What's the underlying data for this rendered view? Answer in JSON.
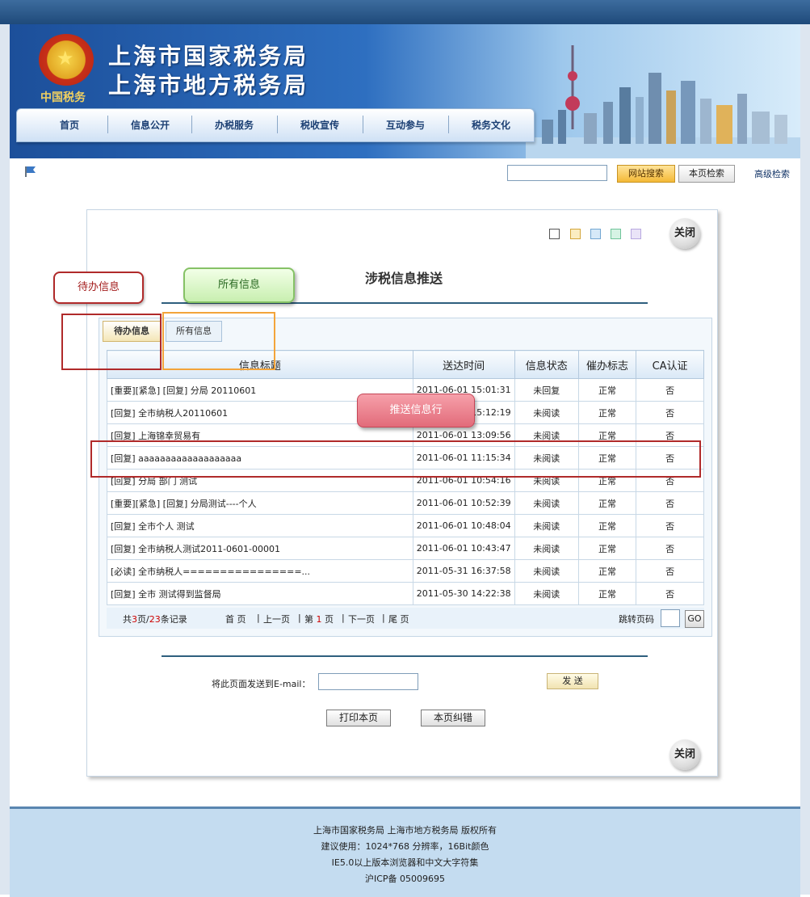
{
  "banner": {
    "title_line1": "上海市国家税务局",
    "title_line2": "上海市地方税务局",
    "emblem_caption": "中国税务"
  },
  "nav": {
    "items": [
      "首页",
      "信息公开",
      "办税服务",
      "税收宣传",
      "互动参与",
      "税务文化"
    ]
  },
  "toolbar": {
    "search_value": "",
    "site_search_label": "网站搜索",
    "page_search_label": "本页检索",
    "advanced_search_label": "高级检索"
  },
  "panel": {
    "close_label": "关闭",
    "title": "涉税信息推送",
    "color_swatches": [
      "#ffffff",
      "#f9e7a8",
      "#d0e6f7",
      "#ccf0dc",
      "#e4dcf5"
    ]
  },
  "tabs": {
    "pending": "待办信息",
    "all": "所有信息"
  },
  "table": {
    "headers": [
      "信息标题",
      "送达时间",
      "信息状态",
      "催办标志",
      "CA认证"
    ],
    "rows": [
      [
        "[重要][紧急] [回复] 分局 20110601",
        "2011-06-01 15:01:31",
        "未回复",
        "正常",
        "否"
      ],
      [
        "[回复] 全市纳税人20110601",
        "2011-06-01 15:12:19",
        "未阅读",
        "正常",
        "否"
      ],
      [
        "[回复] 上海锦幸贸易有",
        "2011-06-01 13:09:56",
        "未阅读",
        "正常",
        "否"
      ],
      [
        "[回复] aaaaaaaaaaaaaaaaaaa",
        "2011-06-01 11:15:34",
        "未阅读",
        "正常",
        "否"
      ],
      [
        "[回复] 分局 部门 测试",
        "2011-06-01 10:54:16",
        "未阅读",
        "正常",
        "否"
      ],
      [
        "[重要][紧急] [回复] 分局测试----个人",
        "2011-06-01 10:52:39",
        "未阅读",
        "正常",
        "否"
      ],
      [
        "[回复] 全市个人 测试",
        "2011-06-01 10:48:04",
        "未阅读",
        "正常",
        "否"
      ],
      [
        "[回复] 全市纳税人测试2011-0601-00001",
        "2011-06-01 10:43:47",
        "未阅读",
        "正常",
        "否"
      ],
      [
        "[必读] 全市纳税人================...",
        "2011-05-31 16:37:58",
        "未阅读",
        "正常",
        "否"
      ],
      [
        "[回复] 全市 测试得到监督局",
        "2011-05-30 14:22:38",
        "未阅读",
        "正常",
        "否"
      ]
    ]
  },
  "pager": {
    "total_prefix": "共",
    "total_pages": "3",
    "pages_unit": "页/",
    "total_records": "23",
    "records_unit": "条记录",
    "first": "首 页",
    "prev": "上一页",
    "page_prefix": "第",
    "current_page": "1",
    "page_suffix": "页",
    "next": "下一页",
    "last": "尾 页",
    "jump_label": "跳转页码",
    "jump_value": "",
    "go_label": "GO"
  },
  "email": {
    "label": "将此页面发送到E-mail：",
    "value": "",
    "send_label": "发 送"
  },
  "actions": {
    "print_label": "打印本页",
    "correct_label": "本页纠错"
  },
  "annotations": {
    "pending_callout": "待办信息",
    "all_callout": "所有信息",
    "row_callout": "推送信息行"
  },
  "footer": {
    "line1": "上海市国家税务局  上海市地方税务局 版权所有",
    "line2": "建议使用：1024*768 分辨率，16Bit颜色",
    "line3": "IE5.0以上版本浏览器和中文大字符集",
    "line4": "沪ICP备 05009695"
  }
}
